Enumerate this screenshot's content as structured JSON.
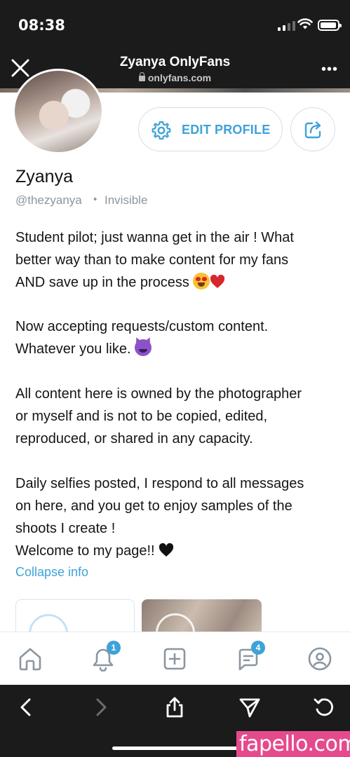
{
  "status_bar": {
    "time": "08:38"
  },
  "browser": {
    "title": "Zyanya OnlyFans",
    "url": "onlyfans.com"
  },
  "profile": {
    "edit_label": "EDIT PROFILE",
    "name": "Zyanya",
    "handle": "@thezyanya",
    "separator": "•",
    "status": "Invisible",
    "bio": {
      "p1_line1": "Student pilot; just wanna get in the air ! What",
      "p1_line2": "better way than to make content for my fans",
      "p1_line3": "AND save up in the process",
      "p2_line1": "Now accepting requests/custom content.",
      "p2_line2": "Whatever you like.",
      "p3_line1": "All content here is owned by the photographer",
      "p3_line2": "or myself and is not to be copied, edited,",
      "p3_line3": "reproduced, or shared in any capacity.",
      "p4_line1": "Daily selfies posted, I respond to all messages",
      "p4_line2": "on here, and you get to enjoy samples of the",
      "p4_line3": "shoots I create !",
      "p4_line4": "Welcome to my page!!"
    },
    "collapse_label": "Collapse info"
  },
  "tabbar": {
    "items": [
      {
        "icon": "home-icon"
      },
      {
        "icon": "bell-icon",
        "badge": "1"
      },
      {
        "icon": "plus-square-icon"
      },
      {
        "icon": "messages-icon",
        "badge": "4"
      },
      {
        "icon": "profile-icon"
      }
    ]
  },
  "watermark": "fapello.com",
  "colors": {
    "accent": "#3ea2d8",
    "dark_chrome": "#1b1b1b",
    "watermark_bg": "#e54b8c"
  }
}
